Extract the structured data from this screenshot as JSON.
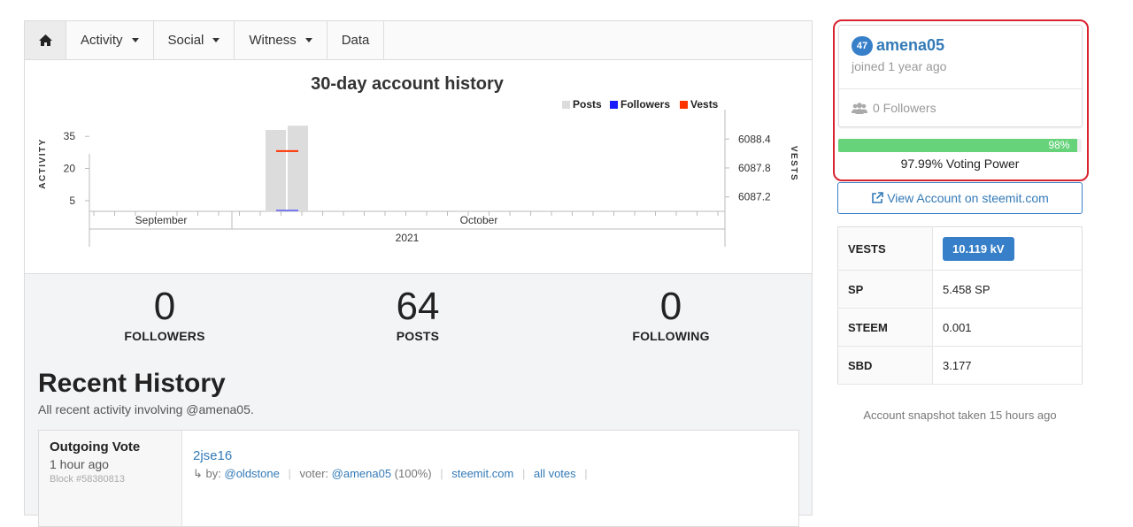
{
  "nav": {
    "home_icon": "home-icon",
    "items": [
      {
        "label": "Activity",
        "dropdown": true
      },
      {
        "label": "Social",
        "dropdown": true
      },
      {
        "label": "Witness",
        "dropdown": true
      },
      {
        "label": "Data",
        "dropdown": false
      }
    ]
  },
  "chart_data": {
    "type": "bar",
    "title": "30-day account history",
    "legend": [
      {
        "name": "Posts",
        "color": "#dcdcdc"
      },
      {
        "name": "Followers",
        "color": "#1a1aff"
      },
      {
        "name": "Vests",
        "color": "#ff3300"
      }
    ],
    "legend_position": "top-right",
    "ylabel": "ACTIVITY",
    "y2label": "VESTS",
    "yticks": [
      5,
      20,
      35
    ],
    "ylim": [
      0,
      45
    ],
    "y2ticks": [
      "6087.2",
      "6087.8",
      "6088.4"
    ],
    "y2lim": [
      6086.9,
      6088.9
    ],
    "xticks": [
      "September",
      "October"
    ],
    "xgroup": "2021",
    "series": [
      {
        "name": "Posts",
        "values": [
          38,
          40
        ]
      },
      {
        "name": "Vests",
        "values": [
          6088.15
        ]
      },
      {
        "name": "Followers",
        "values": [
          0
        ]
      }
    ]
  },
  "stats": [
    {
      "value": "0",
      "label": "FOLLOWERS"
    },
    {
      "value": "64",
      "label": "POSTS"
    },
    {
      "value": "0",
      "label": "FOLLOWING"
    }
  ],
  "recent": {
    "title": "Recent History",
    "subtitle": "All recent activity involving @amena05."
  },
  "history": [
    {
      "type": "Outgoing Vote",
      "time": "1 hour ago",
      "block": "Block #58380813",
      "link": "2jse16",
      "by_prefix": "by:",
      "author": "@oldstone",
      "voter_prefix": "voter:",
      "voter": "@amena05",
      "weight": "(100%)",
      "site": "steemit.com",
      "all_votes": "all votes"
    }
  ],
  "profile": {
    "reputation": "47",
    "username": "amena05",
    "joined": "joined 1 year ago",
    "followers": "0 Followers"
  },
  "voting": {
    "fraction": 0.98,
    "pct_label": "98%",
    "text": "97.99% Voting Power"
  },
  "view_account": "View Account on steemit.com",
  "balances": [
    {
      "key": "VESTS",
      "value": "10.119 kV",
      "pill": true
    },
    {
      "key": "SP",
      "value": "5.458 SP",
      "pill": false
    },
    {
      "key": "STEEM",
      "value": "0.001",
      "pill": false
    },
    {
      "key": "SBD",
      "value": "3.177",
      "pill": false
    }
  ],
  "snapshot": "Account snapshot taken 15 hours ago",
  "colors": {
    "accent": "#3780c9",
    "link": "#337ab7",
    "highlight": "#d9232e",
    "vp_green": "#66d37b"
  }
}
